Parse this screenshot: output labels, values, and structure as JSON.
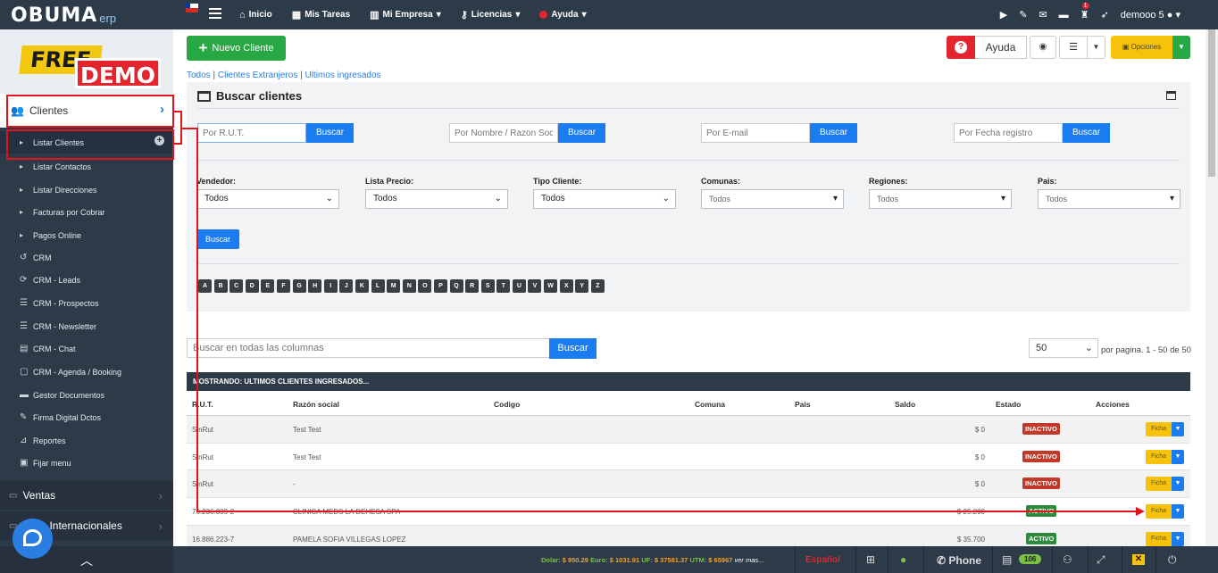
{
  "topbar": {
    "logo": "OBUMA",
    "logo_suffix": "erp",
    "nav": [
      {
        "label": "Inicio",
        "icon": "home-icon"
      },
      {
        "label": "Mis Tareas",
        "icon": "calendar-icon"
      },
      {
        "label": "Mi Empresa",
        "icon": "building-icon",
        "dropdown": true
      },
      {
        "label": "Licencias",
        "icon": "key-icon",
        "dropdown": true
      },
      {
        "label": "Ayuda",
        "icon": "help-icon",
        "dropdown": true
      }
    ],
    "notification_count": "1",
    "user": "demooo 5"
  },
  "sidebar": {
    "promo_free": "FREE",
    "promo_demo": "DEMO",
    "section": "Clientes",
    "items": [
      {
        "label": "Listar Clientes",
        "icon": "caret-right-icon"
      },
      {
        "label": "Listar Contactos",
        "icon": "caret-right-icon"
      },
      {
        "label": "Listar Direcciones",
        "icon": "caret-right-icon"
      },
      {
        "label": "Facturas por Cobrar",
        "icon": "caret-right-icon"
      },
      {
        "label": "Pagos Online",
        "icon": "caret-right-icon"
      },
      {
        "label": "CRM",
        "icon": "history-icon"
      },
      {
        "label": "CRM - Leads",
        "icon": "refresh-icon"
      },
      {
        "label": "CRM - Prospectos",
        "icon": "list-icon"
      },
      {
        "label": "CRM - Newsletter",
        "icon": "list-icon"
      },
      {
        "label": "CRM - Chat",
        "icon": "chat-icon"
      },
      {
        "label": "CRM - Agenda / Booking",
        "icon": "calendar-icon"
      },
      {
        "label": "Gestor Documentos",
        "icon": "folder-icon"
      },
      {
        "label": "Firma Digital Dctos",
        "icon": "pen-icon"
      },
      {
        "label": "Reportes",
        "icon": "chart-icon"
      },
      {
        "label": "Fijar menu",
        "icon": "lock-icon"
      }
    ],
    "groups": [
      "Ventas",
      "Ventas Internacionales"
    ],
    "groups_visible": [
      "Ventas",
      "as Internacionales"
    ]
  },
  "toolbar": {
    "new_client": "Nuevo Cliente",
    "help": "Ayuda",
    "options": "Opciones"
  },
  "breadcrumbs": [
    "Todos",
    "Clientes Extranjeros",
    "Ultimos ingresados"
  ],
  "search_panel": {
    "title": "Buscar clientes",
    "fields": [
      {
        "placeholder": "Por R.U.T.",
        "button": "Buscar"
      },
      {
        "placeholder": "Por Nombre / Razon Social",
        "button": "Buscar"
      },
      {
        "placeholder": "Por E-mail",
        "button": "Buscar"
      },
      {
        "placeholder": "Por Fecha registro",
        "button": "Buscar"
      }
    ],
    "filters": [
      {
        "label": "Vendedor:",
        "value": "Todos"
      },
      {
        "label": "Lista Precio:",
        "value": "Todos"
      },
      {
        "label": "Tipo Cliente:",
        "value": "Todos"
      },
      {
        "label": "Comunas:",
        "value": "Todos"
      },
      {
        "label": "Regiones:",
        "value": "Todos"
      },
      {
        "label": "Pais:",
        "value": "Todos"
      }
    ],
    "filter_button": "Buscar",
    "letters": [
      "A",
      "B",
      "C",
      "D",
      "E",
      "F",
      "G",
      "H",
      "I",
      "J",
      "K",
      "L",
      "M",
      "N",
      "O",
      "P",
      "Q",
      "R",
      "S",
      "T",
      "U",
      "V",
      "W",
      "X",
      "Y",
      "Z"
    ]
  },
  "table_search": {
    "placeholder": "Buscar en todas las columnas",
    "button": "Buscar",
    "per_page": "50",
    "per_page_text": "por pagina. 1 - 50 de 50"
  },
  "table": {
    "caption": "MOSTRANDO: ULTIMOS CLIENTES INGRESADOS...",
    "columns": [
      "R.U.T.",
      "Razón social",
      "Codigo",
      "Comuna",
      "Pais",
      "Saldo",
      "Estado",
      "Acciones"
    ],
    "rows": [
      {
        "rut": "SinRut",
        "razon": "Test Test",
        "saldo": "$ 0",
        "estado": "INACTIVO",
        "accion": "Ficha"
      },
      {
        "rut": "SinRut",
        "razon": "Test Test",
        "saldo": "$ 0",
        "estado": "INACTIVO",
        "accion": "Ficha"
      },
      {
        "rut": "SinRut",
        "razon": "-",
        "saldo": "$ 0",
        "estado": "INACTIVO",
        "accion": "Ficha"
      },
      {
        "rut": "76.236.039-2",
        "razon": "CLINICA MEDS LA DEHESA SPA",
        "saldo": "$ 25.200",
        "estado": "ACTIVO",
        "accion": "Ficha"
      },
      {
        "rut": "16.886.223-7",
        "razon": "PAMELA SOFIA VILLEGAS LOPEZ",
        "saldo": "$ 35.700",
        "estado": "ACTIVO",
        "accion": "Ficha"
      }
    ]
  },
  "footer": {
    "dolar_label": "Dolar:",
    "dolar": "$ 950.29",
    "euro_label": "Euro:",
    "euro": "$ 1031.91",
    "uf_label": "UF:",
    "uf": "$ 37581.37",
    "utm_label": "UTM:",
    "utm": "$ 65967",
    "more": "ver mas...",
    "language": "Español",
    "phone": "Phone",
    "chat_count": "106"
  },
  "colors": {
    "navbar": "#2d3a48",
    "primary": "#1b7cf0",
    "success": "#28a745",
    "warning": "#f7c20a",
    "danger": "#e3262e",
    "highlight": "#e3121b"
  }
}
